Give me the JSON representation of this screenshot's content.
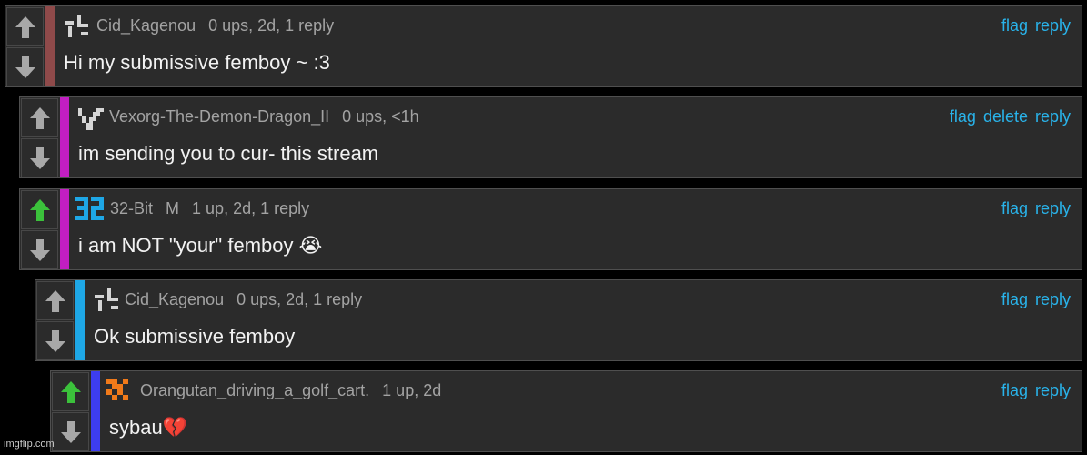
{
  "colors": {
    "link": "#29b3ea",
    "arrow_inactive": "#a8a8a8",
    "arrow_upvoted": "#3bc13b"
  },
  "comments": [
    {
      "username": "Cid_Kagenou",
      "badge": "",
      "meta": "0 ups, 2d, 1 reply",
      "text": "Hi my submissive femboy ~ :3",
      "actions": [
        "flag",
        "reply"
      ],
      "bar_color": "#8f4a4a",
      "upvoted": false,
      "avatar": "cid-avatar-icon"
    },
    {
      "username": "Vexorg-The-Demon-Dragon_II",
      "badge": "",
      "meta": "0 ups, <1h",
      "text": "im sending you to cur- this stream",
      "actions": [
        "flag",
        "delete",
        "reply"
      ],
      "bar_color": "#c21ec2",
      "upvoted": false,
      "avatar": "vexorg-avatar-icon"
    },
    {
      "username": "32-Bit",
      "badge": "M",
      "meta": "1 up, 2d, 1 reply",
      "text": "i am NOT \"your\" femboy 😭",
      "actions": [
        "flag",
        "reply"
      ],
      "bar_color": "#c21ec2",
      "upvoted": true,
      "avatar": "32-bit-avatar-icon"
    },
    {
      "username": "Cid_Kagenou",
      "badge": "",
      "meta": "0 ups, 2d, 1 reply",
      "text": "Ok submissive femboy",
      "actions": [
        "flag",
        "reply"
      ],
      "bar_color": "#1ea7e6",
      "upvoted": false,
      "avatar": "cid-avatar-icon"
    },
    {
      "username": "Orangutan_driving_a_golf_cart.",
      "badge": "",
      "meta": "1 up, 2d",
      "text": "sybau💔",
      "actions": [
        "flag",
        "reply"
      ],
      "bar_color": "#3d3df0",
      "upvoted": true,
      "avatar": "orangutan-avatar-icon"
    }
  ],
  "watermark": "imgflip.com"
}
